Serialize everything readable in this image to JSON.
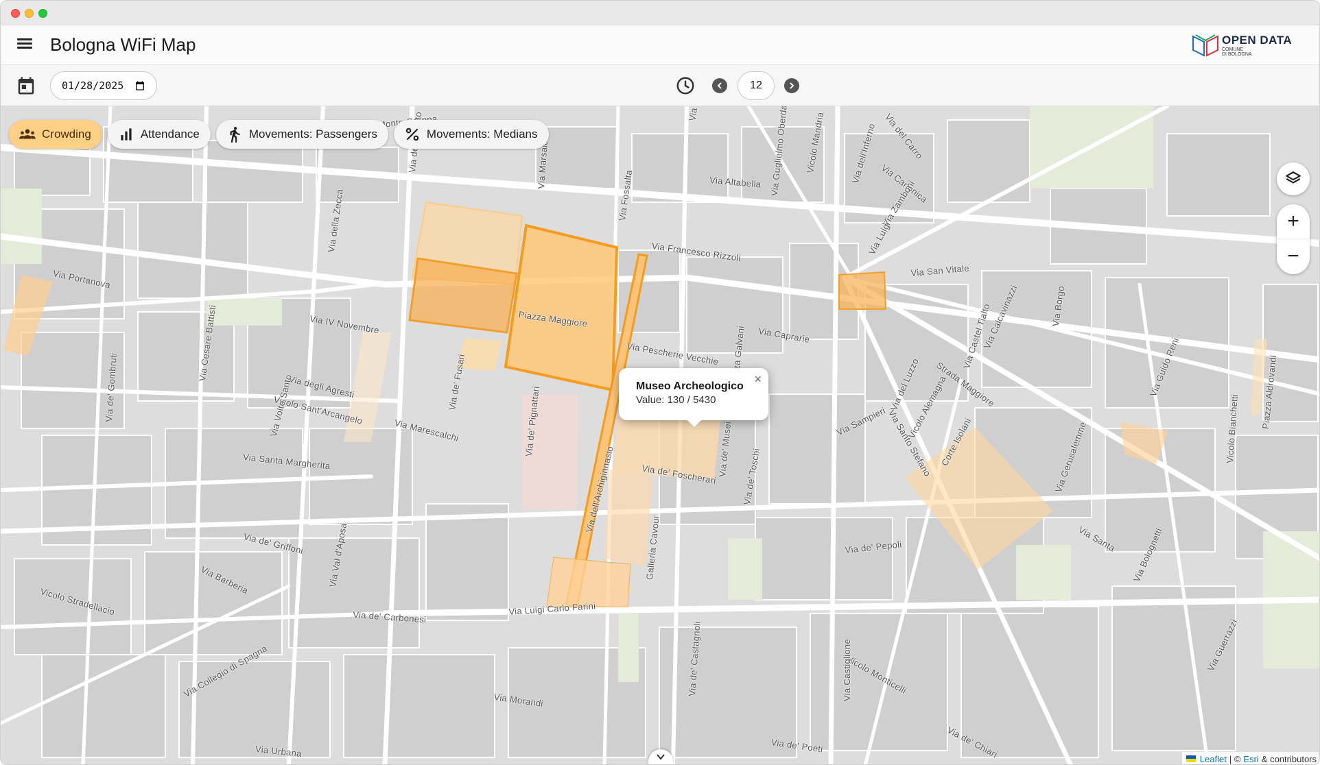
{
  "window": {
    "controls": [
      "close",
      "minimize",
      "maximize"
    ]
  },
  "app": {
    "title": "Bologna WiFi Map",
    "menu_icon": "hamburger-icon"
  },
  "logo": {
    "main": "OPEN DATA",
    "sub1": "COMUNE",
    "sub2": "DI BOLOGNA"
  },
  "toolbar": {
    "date_value": "01/28/2025",
    "hour_value": "12",
    "icons": {
      "calendar": "calendar-icon",
      "clock": "clock-icon",
      "prev": "chevron-left-icon",
      "next": "chevron-right-icon"
    }
  },
  "layers": [
    {
      "label": "Crowding",
      "icon": "people-icon",
      "active": true
    },
    {
      "label": "Attendance",
      "icon": "bar-chart-icon",
      "active": false
    },
    {
      "label": "Movements: Passengers",
      "icon": "walking-icon",
      "active": false
    },
    {
      "label": "Movements: Medians",
      "icon": "percent-icon",
      "active": false
    }
  ],
  "map_controls": {
    "zoom_in": "+",
    "zoom_out": "−",
    "layers_icon": "layers-icon"
  },
  "popup": {
    "title": "Museo Archeologico",
    "value": "Value: 130 / 5430",
    "close": "×"
  },
  "attribution": {
    "leaflet": "Leaflet",
    "sep": "| ©",
    "esri": "Esri",
    "rest": "& contributors"
  },
  "streets": [
    "Via Monte Grappa",
    "Via Sant'Al",
    "Via Guglielmo Oberdan",
    "Vicolo Mandria",
    "Via dell'Inferno",
    "Via del Carro",
    "Via Canonica",
    "Via Altabella",
    "Via Zamboni",
    "Via Luigi",
    "Via Francesco Rizzoli",
    "Via San Vitale",
    "Via Portanova",
    "Via IV Novembre",
    "Piazza Maggiore",
    "Via Pescherie Vecchie",
    "Via Caprarie",
    "Strada Maggiore",
    "Via degli Agresti",
    "Vicolo Sant'Arcangelo",
    "Via Marescalchi",
    "Via Santa Margherita",
    "Via de' Foscherari",
    "Via de' Griffoni",
    "Via Barberia",
    "Vicolo Stradellacio",
    "Via de' Carbonesi",
    "Via Luigi Carlo Farini",
    "Via Collegio di Spagna",
    "Via Urbana",
    "Via Morandi",
    "Via de' Pepoli",
    "Vicolo Monticelli",
    "Via de' Chiari",
    "Via de' Toschi",
    "Via Sampieri",
    "Via Santo Stefano",
    "Corte Isolani",
    "Via Guerrazzi",
    "Via della Zecca",
    "Via Fossalta",
    "Via de' Fusari",
    "Via de' Pignattari",
    "Galleria Cavour",
    "Via dell'Archiginnasio",
    "Via Castiglione",
    "Via Cesare Battisti",
    "Via Volto Santo",
    "Via de' Gombruti",
    "Via Val d'Aposa",
    "Via Santa",
    "Via Bolognetti",
    "Via Guido Reni",
    "Via Gerusalemme",
    "Piazza Aldrovandi",
    "Vicolo Bianchetti",
    "Via de' Poeti",
    "Via de' Castagnoli",
    "Via del Luzzo",
    "Vicolo Alemagna",
    "Via Castel Tialto",
    "Via Calcavinazzi",
    "Via Borgo",
    "Via Marsala",
    "Via del Guasto",
    "Piazza Galvani",
    "Via de' Musei",
    "Via Francesco Rizzoli"
  ]
}
